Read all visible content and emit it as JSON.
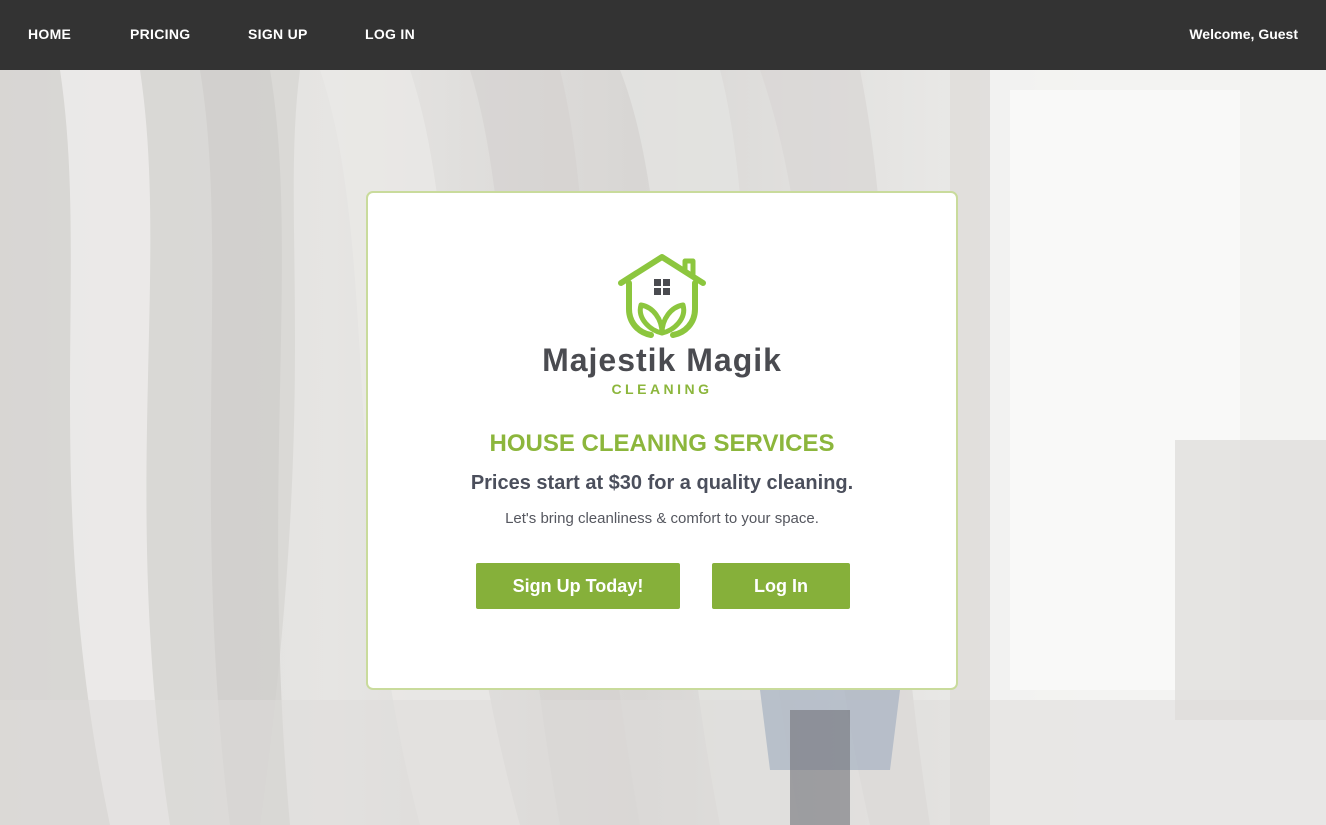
{
  "nav": {
    "items": [
      {
        "label": "HOME"
      },
      {
        "label": "PRICING"
      },
      {
        "label": "SIGN UP"
      },
      {
        "label": "LOG IN"
      }
    ],
    "welcome": "Welcome, Guest"
  },
  "card": {
    "brand_name": "Majestik Magik",
    "brand_sub": "CLEANING",
    "heading": "HOUSE CLEANING SERVICES",
    "subheading": "Prices start at $30 for a quality cleaning.",
    "tagline": "Let's bring cleanliness & comfort to your space.",
    "signup_button": "Sign Up Today!",
    "login_button": "Log In"
  },
  "icons": {
    "logo": "house-with-leaves-icon"
  },
  "colors": {
    "navbar": "#333333",
    "accent_green": "#86b03a",
    "brand_text": "#4a4b50",
    "card_border": "#c9db9c"
  }
}
